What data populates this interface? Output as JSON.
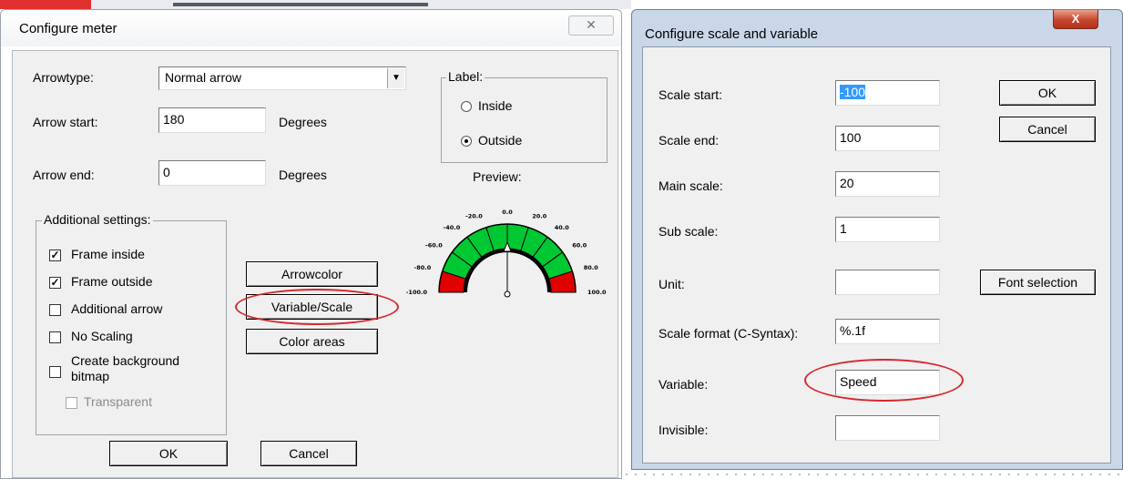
{
  "meter_dialog": {
    "title": "Configure meter",
    "close_glyph": "✕",
    "arrowtype_label": "Arrowtype:",
    "arrowtype_value": "Normal arrow",
    "arrow_start_label": "Arrow start:",
    "arrow_start_value": "180",
    "arrow_start_unit": "Degrees",
    "arrow_end_label": "Arrow end:",
    "arrow_end_value": "0",
    "arrow_end_unit": "Degrees",
    "label_group": {
      "legend": "Label:",
      "inside": "Inside",
      "outside": "Outside",
      "selected": "outside"
    },
    "preview_label": "Preview:",
    "preview_ticks": [
      "-100.0",
      "-80.0",
      "-60.0",
      "-40.0",
      "-20.0",
      "0.0",
      "20.0",
      "40.0",
      "60.0",
      "80.0",
      "100.0"
    ],
    "additional": {
      "legend": "Additional settings:",
      "frame_inside": "Frame inside",
      "frame_inside_checked": true,
      "frame_outside": "Frame outside",
      "frame_outside_checked": true,
      "additional_arrow": "Additional arrow",
      "no_scaling": "No Scaling",
      "create_bg_line1": "Create background",
      "create_bg_line2": "bitmap",
      "transparent": "Transparent"
    },
    "arrowcolor_button": "Arrowcolor",
    "variable_scale_button": "Variable/Scale",
    "color_areas_button": "Color areas",
    "ok_button": "OK",
    "cancel_button": "Cancel"
  },
  "scale_dialog": {
    "title": "Configure scale and variable",
    "close_glyph": "X",
    "scale_start_label": "Scale start:",
    "scale_start_value": "-100",
    "scale_end_label": "Scale end:",
    "scale_end_value": "100",
    "main_scale_label": "Main scale:",
    "main_scale_value": "20",
    "sub_scale_label": "Sub scale:",
    "sub_scale_value": "1",
    "unit_label": "Unit:",
    "unit_value": "",
    "scale_format_label": "Scale format (C-Syntax):",
    "scale_format_value": "%.1f",
    "variable_label": "Variable:",
    "variable_value": "Speed",
    "invisible_label": "Invisible:",
    "invisible_value": "",
    "ok_button": "OK",
    "cancel_button": "Cancel",
    "font_selection_button": "Font selection"
  },
  "colors": {
    "highlight": "#d7262c",
    "gauge_green": "#00c832",
    "gauge_red": "#e00000"
  }
}
